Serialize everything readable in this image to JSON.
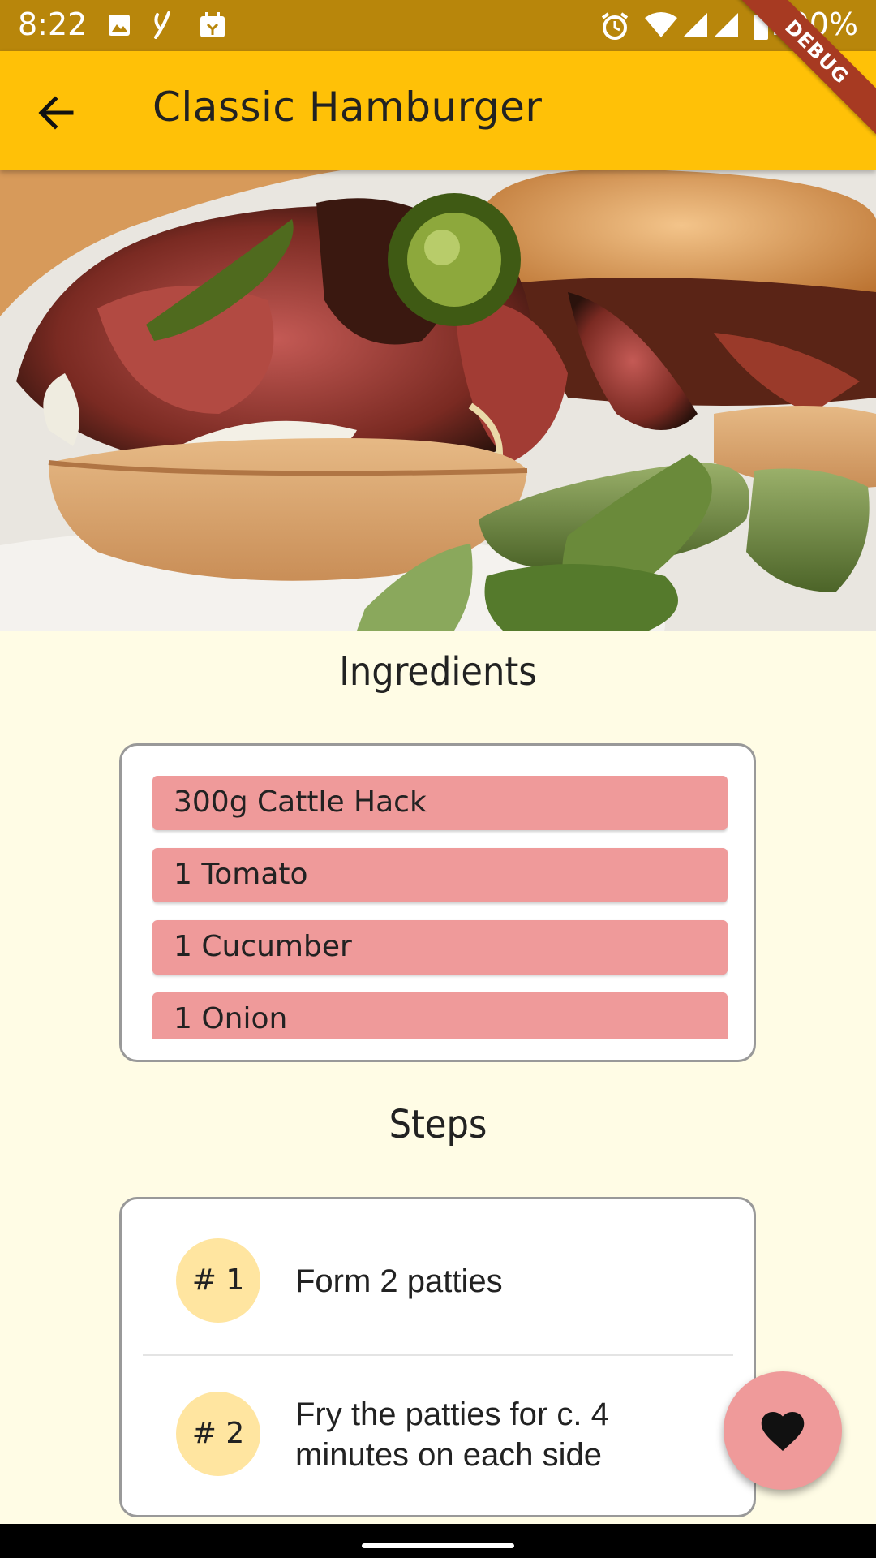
{
  "status_bar": {
    "time": "8:22",
    "battery": "100%"
  },
  "debug_banner": "DEBUG",
  "app_bar": {
    "title": "Classic Hamburger"
  },
  "ingredients": {
    "title": "Ingredients",
    "items": [
      "300g Cattle Hack",
      "1 Tomato",
      "1 Cucumber",
      "1 Onion"
    ]
  },
  "steps": {
    "title": "Steps",
    "items": [
      {
        "badge": "# 1",
        "text": "Form 2 patties"
      },
      {
        "badge": "# 2",
        "text": "Fry the patties for c. 4 minutes on each side"
      }
    ]
  },
  "colors": {
    "app_bar": "#ffc107",
    "status_bar": "#b8860b",
    "accent": "#ef9a9a",
    "badge": "#ffe5a0",
    "background": "#fffce5"
  }
}
